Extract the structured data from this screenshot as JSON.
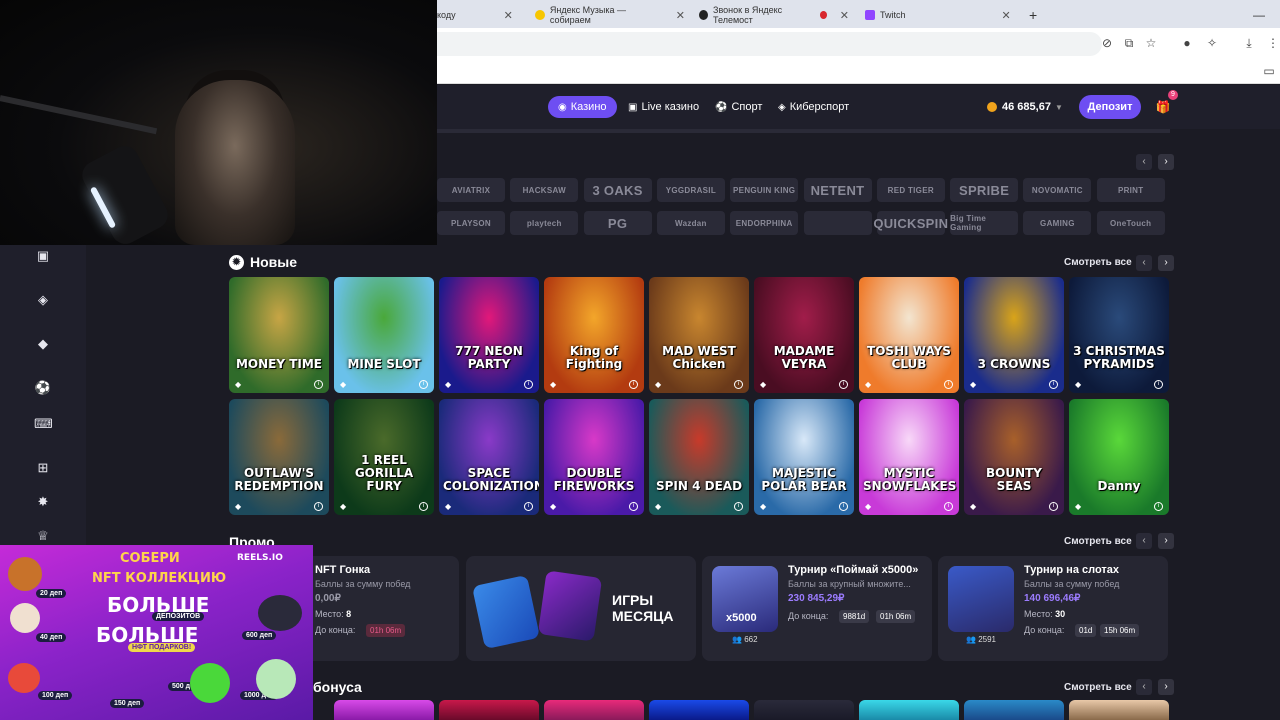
{
  "browser": {
    "tabs": [
      {
        "label": "коду"
      },
      {
        "label": "Яндекс Музыка — собираем"
      },
      {
        "label": "Звонок в Яндекс Телемост"
      },
      {
        "label": "Twitch"
      }
    ],
    "new_tab": "+"
  },
  "header": {
    "nav": [
      {
        "label": "Казино",
        "icon": "casino-icon"
      },
      {
        "label": "Live казино",
        "icon": "live-icon"
      },
      {
        "label": "Спорт",
        "icon": "ball-icon"
      },
      {
        "label": "Киберспорт",
        "icon": "gamepad-icon"
      }
    ],
    "balance": "46 685,67",
    "deposit_label": "Депозит",
    "notifications": "9"
  },
  "providers": {
    "row1": [
      "AVIATRIX",
      "HACKSAW",
      "3 OAKS",
      "YGGDRASIL",
      "PENGUIN KING",
      "NETENT",
      "RED TIGER",
      "SPRIBE",
      "NOVOMATIC",
      "PRINT"
    ],
    "row2": [
      "PLAYSON",
      "playtech",
      "PG",
      "Wazdan",
      "ENDORPHINA",
      "",
      "QUICKSPIN",
      "Big Time Gaming",
      "GAMING",
      "OneTouch"
    ]
  },
  "new_section": {
    "title": "Новые",
    "see_all": "Смотреть все",
    "games": [
      {
        "title": "MONEY TIME",
        "color1": "#2f6b2a",
        "color2": "#c7a545"
      },
      {
        "title": "MINE SLOT",
        "color1": "#6ac1ea",
        "color2": "#4aa83a"
      },
      {
        "title": "777 NEON PARTY",
        "color1": "#1a1a8c",
        "color2": "#e2187a"
      },
      {
        "title": "King of Fighting",
        "color1": "#b33b10",
        "color2": "#f3a62a"
      },
      {
        "title": "MAD WEST Chicken",
        "color1": "#6b3a1a",
        "color2": "#c8862f"
      },
      {
        "title": "MADAME VEYRA",
        "color1": "#4a0d22",
        "color2": "#a11d4a"
      },
      {
        "title": "TOSHI WAYS CLUB",
        "color1": "#ef7b2b",
        "color2": "#f3e5d0"
      },
      {
        "title": "3 CROWNS",
        "color1": "#1a2c8c",
        "color2": "#d9a419"
      },
      {
        "title": "3 CHRISTMAS PYRAMIDS",
        "color1": "#0d1a3a",
        "color2": "#2a4a7a"
      },
      {
        "title": "OUTLAW'S REDEMPTION",
        "color1": "#1d4a5c",
        "color2": "#8a6a3a"
      },
      {
        "title": "1 REEL GORILLA FURY",
        "color1": "#0d3a1a",
        "color2": "#4a6a2a"
      },
      {
        "title": "SPACE COLONIZATION",
        "color1": "#1a2a7a",
        "color2": "#8a3ac8"
      },
      {
        "title": "DOUBLE FIREWORKS",
        "color1": "#4a1aa8",
        "color2": "#d839c8"
      },
      {
        "title": "SPIN 4 DEAD",
        "color1": "#1a5a5a",
        "color2": "#c83a2a"
      },
      {
        "title": "MAJESTIC POLAR BEAR",
        "color1": "#2a6aa8",
        "color2": "#d8e8f8"
      },
      {
        "title": "MYSTIC SNOWFLAKES",
        "color1": "#c83ad8",
        "color2": "#f8d8f8"
      },
      {
        "title": "BOUNTY SEAS",
        "color1": "#3a1a4a",
        "color2": "#a8602a"
      },
      {
        "title": "Danny",
        "color1": "#1a7a2a",
        "color2": "#5ad83a"
      }
    ]
  },
  "promo": {
    "title": "Промо",
    "see_all": "Смотреть все",
    "cards": [
      {
        "title": "NFT Гонка",
        "sub": "Баллы за сумму побед",
        "amount": "0,00₽",
        "place_label": "Место:",
        "place": "8",
        "until_label": "До конца:",
        "timer1": "01h 06m"
      },
      {
        "title": "ИГРЫ МЕСЯЦА"
      },
      {
        "title": "Турнир «Поймай x5000»",
        "sub": "Баллы за крупный множите...",
        "amount": "230 845,29₽",
        "until_label": "До конца:",
        "timer1": "9881d",
        "timer2": "01h 06m",
        "players": "662",
        "badge": "x5000"
      },
      {
        "title": "Турнир на слотах",
        "sub": "Баллы за сумму побед",
        "amount": "140 696,46₽",
        "place_label": "Место:",
        "place": "30",
        "until_label": "До конца:",
        "timer1": "01d",
        "timer2": "15h 06m",
        "players": "2591"
      }
    ]
  },
  "bonus_section": {
    "title": "бонуса",
    "see_all": "Смотреть все"
  },
  "ad": {
    "line1": "СОБЕРИ",
    "line2": "NFT КОЛЛЕКЦИЮ",
    "line3": "БОЛЬШЕ",
    "pill": "ДЕПОЗИТОВ",
    "line4": "БОЛЬШЕ",
    "line5": "НФТ ПОДАРКОВ!",
    "brand": "REELS.IO",
    "tags": [
      "20 деп",
      "40 деп",
      "100 деп",
      "150 деп",
      "500 деп",
      "600 деп",
      "1000 деп"
    ]
  }
}
